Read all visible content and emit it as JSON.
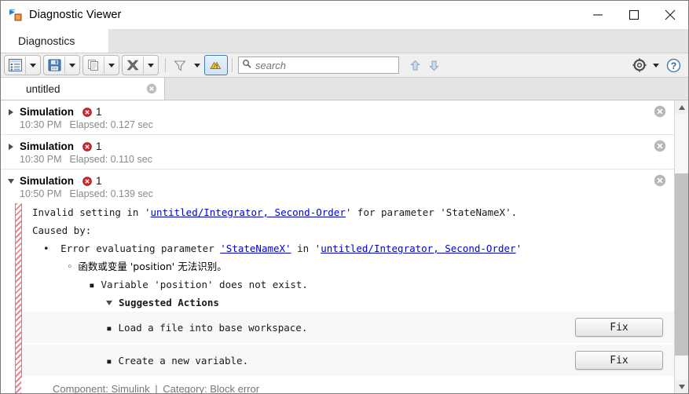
{
  "window": {
    "title": "Diagnostic Viewer",
    "app_icon": "simulink-icon",
    "minimize": "minimize-icon",
    "maximize": "maximize-icon",
    "close": "close-icon"
  },
  "tabs": {
    "diagnostics_label": "Diagnostics"
  },
  "toolbar": {
    "buttons": [
      {
        "name": "view-settings-button",
        "icon": "list-view-icon",
        "has_dropdown": true
      },
      {
        "name": "save-button",
        "icon": "floppy-disk-icon",
        "has_dropdown": true
      },
      {
        "name": "copy-button",
        "icon": "copy-pages-icon",
        "has_dropdown": true
      },
      {
        "name": "clear-button",
        "icon": "gray-x-icon",
        "has_dropdown": true
      },
      {
        "name": "filter-button",
        "icon": "funnel-icon",
        "has_dropdown": true
      },
      {
        "name": "warnings-toggle-button",
        "icon": "warning-triangles-icon",
        "has_dropdown": false,
        "selected": true
      }
    ],
    "search": {
      "placeholder": "search",
      "value": "",
      "icon": "search-icon"
    },
    "nav_prev_icon": "arrow-up-icon",
    "nav_next_icon": "arrow-down-icon",
    "settings_icon": "gear-icon",
    "settings_has_dropdown": true,
    "help_icon": "help-question-icon"
  },
  "document_tab": {
    "label": "untitled",
    "close_icon": "tab-close-icon"
  },
  "simulations": [
    {
      "title": "Simulation",
      "status_icon": "error-circle-icon",
      "count": "1",
      "time": "10:30 PM",
      "elapsed": "Elapsed: 0.127 sec",
      "expanded": false,
      "close_icon": "row-close-icon"
    },
    {
      "title": "Simulation",
      "status_icon": "error-circle-icon",
      "count": "1",
      "time": "10:30 PM",
      "elapsed": "Elapsed: 0.110 sec",
      "expanded": false,
      "close_icon": "row-close-icon"
    },
    {
      "title": "Simulation",
      "status_icon": "error-circle-icon",
      "count": "1",
      "time": "10:50 PM",
      "elapsed": "Elapsed: 0.139 sec",
      "expanded": true,
      "close_icon": "row-close-icon"
    }
  ],
  "error_detail": {
    "line1": {
      "pre": "Invalid setting in '",
      "link": "untitled/Integrator, Second-Order",
      "post": "' for parameter 'StateNameX'."
    },
    "caused_by": "Caused by:",
    "line2": {
      "pre": "Error evaluating parameter ",
      "link1": "'StateNameX'",
      "mid": " in '",
      "link2": "untitled/Integrator, Second-Order",
      "post": "'"
    },
    "line3_cjk": "函数或变量 'position' 无法识别。",
    "line4": "Variable 'position' does not exist.",
    "suggested_actions_label": "Suggested Actions",
    "actions": [
      {
        "label": "Load a file into base workspace.",
        "button": "Fix"
      },
      {
        "label": "Create a new variable.",
        "button": "Fix"
      }
    ],
    "component_prefix": "Component:",
    "component_value": "Simulink",
    "separator": "|",
    "category_prefix": "Category:",
    "category_value": "Block error"
  },
  "scrollbar": {
    "up_icon": "scroll-up-icon",
    "down_icon": "scroll-down-icon",
    "thumb": "scroll-thumb"
  },
  "colors": {
    "link": "#0000d8",
    "error_red": "#d6282b",
    "hatch_red": "#e8848b",
    "toolbar_bg": "#f0f0f0",
    "tab_strip_bg": "#e4e4e4",
    "action_row_bg": "#f7f7f7"
  }
}
